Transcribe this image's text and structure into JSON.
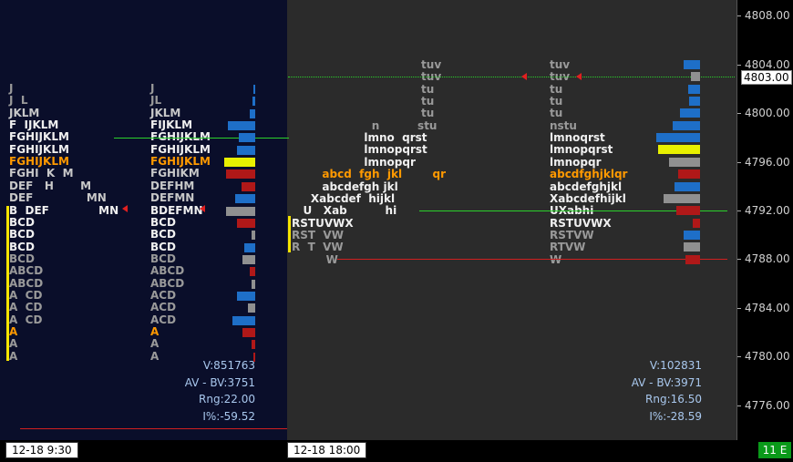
{
  "axis": {
    "prices": [
      "4808.00",
      "4804.00",
      "4800.00",
      "4796.00",
      "4792.00",
      "4788.00",
      "4784.00",
      "4780.00",
      "4776.00"
    ],
    "current": "4803.00"
  },
  "left": {
    "letters": [
      {
        "text": "J",
        "cls": "c-dim"
      },
      {
        "text": "J  L",
        "cls": "c-dim"
      },
      {
        "text": "JKLM",
        "cls": "c-gray"
      },
      {
        "text": "F  IJKLM",
        "cls": "c-white"
      },
      {
        "text": "FGHIJKLM",
        "cls": "c-white"
      },
      {
        "text": "FGHIJKLM",
        "cls": "c-white"
      },
      {
        "text": "FGHIJKLM",
        "cls": "c-orange"
      },
      {
        "text": "FGHI  K  M",
        "cls": "c-gray"
      },
      {
        "text": "DEF   H       M",
        "cls": "c-gray"
      },
      {
        "text": "DEF              MN",
        "cls": "c-gray"
      },
      {
        "text": "B  DEF             MN",
        "cls": "c-white"
      },
      {
        "text": "BCD",
        "cls": "c-white"
      },
      {
        "text": "BCD",
        "cls": "c-white"
      },
      {
        "text": "BCD",
        "cls": "c-white"
      },
      {
        "text": "BCD",
        "cls": "c-dim"
      },
      {
        "text": "ABCD",
        "cls": "c-dim"
      },
      {
        "text": "ABCD",
        "cls": "c-dim"
      },
      {
        "text": "A  CD",
        "cls": "c-dim"
      },
      {
        "text": "A  CD",
        "cls": "c-dim"
      },
      {
        "text": "A  CD",
        "cls": "c-dim"
      },
      {
        "text": "A",
        "cls": "c-orange"
      },
      {
        "text": "A",
        "cls": "c-dim"
      },
      {
        "text": "A",
        "cls": "c-dim"
      }
    ],
    "collapsed": [
      {
        "text": "J",
        "cls": "c-dim"
      },
      {
        "text": "JL",
        "cls": "c-dim"
      },
      {
        "text": "JKLM",
        "cls": "c-gray"
      },
      {
        "text": "FIJKLM",
        "cls": "c-white"
      },
      {
        "text": "FGHIJKLM",
        "cls": "c-white"
      },
      {
        "text": "FGHIJKLM",
        "cls": "c-white"
      },
      {
        "text": "FGHIJKLM",
        "cls": "c-orange"
      },
      {
        "text": "FGHIKM",
        "cls": "c-gray"
      },
      {
        "text": "DEFHM",
        "cls": "c-gray"
      },
      {
        "text": "DEFMN",
        "cls": "c-gray"
      },
      {
        "text": "BDEFMN",
        "cls": "c-white"
      },
      {
        "text": "BCD",
        "cls": "c-white"
      },
      {
        "text": "BCD",
        "cls": "c-white"
      },
      {
        "text": "BCD",
        "cls": "c-white"
      },
      {
        "text": "BCD",
        "cls": "c-dim"
      },
      {
        "text": "ABCD",
        "cls": "c-dim"
      },
      {
        "text": "ABCD",
        "cls": "c-dim"
      },
      {
        "text": "ACD",
        "cls": "c-dim"
      },
      {
        "text": "ACD",
        "cls": "c-dim"
      },
      {
        "text": "ACD",
        "cls": "c-dim"
      },
      {
        "text": "A",
        "cls": "c-orange"
      },
      {
        "text": "A",
        "cls": "c-dim"
      },
      {
        "text": "A",
        "cls": "c-dim"
      }
    ],
    "stats": {
      "v": "V:851763",
      "av": "AV - BV:3751",
      "rng": "Rng:22.00",
      "ipct": "I%:-59.52"
    },
    "time": "12-18  9:30"
  },
  "right": {
    "letters": [
      {
        "text": "                                  tuv",
        "cls": "c-dim"
      },
      {
        "text": "                                  tuv",
        "cls": "c-dim"
      },
      {
        "text": "                                  tu",
        "cls": "c-dim"
      },
      {
        "text": "                                  tu",
        "cls": "c-dim"
      },
      {
        "text": "                                  tu",
        "cls": "c-dim"
      },
      {
        "text": "                     n          stu",
        "cls": "c-dim"
      },
      {
        "text": "                   lmno  qrst",
        "cls": "c-white"
      },
      {
        "text": "                   lmnopqrst",
        "cls": "c-white"
      },
      {
        "text": "                   lmnopqr",
        "cls": "c-white"
      },
      {
        "text": "        abcd  fgh  jkl        qr",
        "cls": "c-orange"
      },
      {
        "text": "        abcdefgh jkl",
        "cls": "c-white"
      },
      {
        "text": "     Xabcdef  hijkl",
        "cls": "c-white"
      },
      {
        "text": "   U   Xab          hi",
        "cls": "c-white"
      },
      {
        "text": "RSTUVWX",
        "cls": "c-white"
      },
      {
        "text": "RST  VW",
        "cls": "c-dim"
      },
      {
        "text": "R  T  VW",
        "cls": "c-dim"
      },
      {
        "text": "         W",
        "cls": "c-dim"
      }
    ],
    "collapsed": [
      {
        "text": "tuv",
        "cls": "c-dim"
      },
      {
        "text": "tuv",
        "cls": "c-dim"
      },
      {
        "text": "tu",
        "cls": "c-dim"
      },
      {
        "text": "tu",
        "cls": "c-dim"
      },
      {
        "text": "tu",
        "cls": "c-dim"
      },
      {
        "text": "nstu",
        "cls": "c-dim"
      },
      {
        "text": "lmnoqrst",
        "cls": "c-white"
      },
      {
        "text": "lmnopqrst",
        "cls": "c-white"
      },
      {
        "text": "lmnopqr",
        "cls": "c-white"
      },
      {
        "text": "abcdfghjklqr",
        "cls": "c-orange"
      },
      {
        "text": "abcdefghjkl",
        "cls": "c-white"
      },
      {
        "text": "Xabcdefhijkl",
        "cls": "c-white"
      },
      {
        "text": "UXabhi",
        "cls": "c-white"
      },
      {
        "text": "RSTUVWX",
        "cls": "c-white"
      },
      {
        "text": "RSTVW",
        "cls": "c-dim"
      },
      {
        "text": "RTVW",
        "cls": "c-dim"
      },
      {
        "text": "W",
        "cls": "c-dim"
      }
    ],
    "stats": {
      "v": "V:102831",
      "av": "AV - BV:3971",
      "rng": "Rng:16.50",
      "ipct": "I%:-28.59"
    },
    "time": "12-18  18:00"
  },
  "status_badge": "11 E",
  "colors": {
    "blue": "#1e6fc8",
    "red": "#b01818",
    "gray": "#909090",
    "yellow": "#e8f000",
    "green": "#2bd12b"
  }
}
